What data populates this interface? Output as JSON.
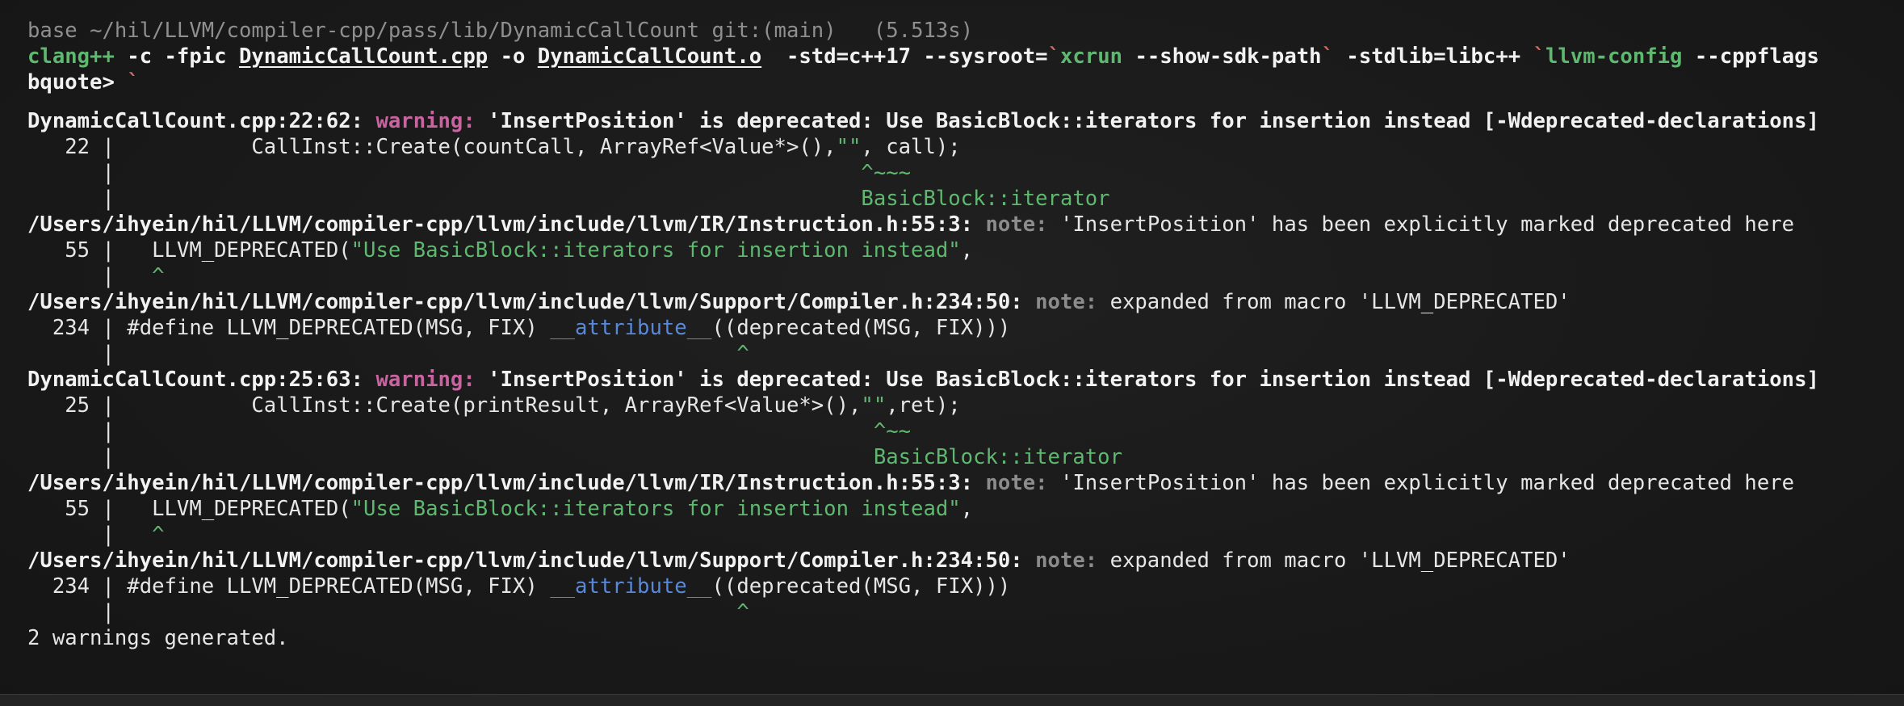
{
  "prompt": {
    "env": "base",
    "path": "~/hil/LLVM/compiler-cpp/pass/lib/DynamicCallCount",
    "git": "git:(main)",
    "duration": "(5.513s)"
  },
  "command": {
    "compiler": "clang++",
    "flags1": " -c -fpic ",
    "source_file": "DynamicCallCount.cpp",
    "out_flag": " -o ",
    "object_file": "DynamicCallCount.o",
    "flags2": "  -std=c++17 --sysroot=",
    "tick1": "`",
    "xcrun": "xcrun",
    "sdk_flag": " --show-sdk-path",
    "tick2": "`",
    "stdlib": " -stdlib=libc++ ",
    "tick3": "`",
    "llvm_config": "llvm-config",
    "cppflags": " --cppflags",
    "bquote": "bquote> ",
    "bquote_tick": "`"
  },
  "diagnostics": [
    {
      "warning_loc": "DynamicCallCount.cpp:22:62:",
      "warning_label": "warning:",
      "warning_msg": " 'InsertPosition' is deprecated: Use BasicBlock::iterators for insertion instead [-Wdeprecated-declarations]",
      "src_gutter": "   22 | ",
      "src_pre": "          CallInst::Create(countCall, ArrayRef<Value*>(),",
      "src_str": "\"\"",
      "src_post": ", call);",
      "caret_gutter": "      | ",
      "caret_pad": "                                                           ",
      "caret": "^~~~",
      "fix_gutter": "      | ",
      "fix_pad": "                                                           ",
      "fix": "BasicBlock::iterator",
      "note1_loc": "/Users/ihyein/hil/LLVM/compiler-cpp/llvm/include/llvm/IR/Instruction.h:55:3:",
      "note1_label": "note:",
      "note1_msg": " 'InsertPosition' has been explicitly marked deprecated here",
      "note1_gutter": "   55 | ",
      "note1_pre": "  LLVM_DEPRECATED(",
      "note1_str": "\"Use BasicBlock::iterators for insertion instead\"",
      "note1_post": ",",
      "note1_caret_gutter": "      | ",
      "note1_caret_pad": "  ",
      "note1_caret": "^",
      "note2_loc": "/Users/ihyein/hil/LLVM/compiler-cpp/llvm/include/llvm/Support/Compiler.h:234:50:",
      "note2_label": "note:",
      "note2_msg": " expanded from macro 'LLVM_DEPRECATED'",
      "note2_gutter": "  234 | ",
      "note2_pre": "#define LLVM_DEPRECATED(MSG, FIX) ",
      "note2_attr": "__attribute__",
      "note2_post": "((deprecated(MSG, FIX)))",
      "note2_caret_gutter": "      | ",
      "note2_caret_pad": "                                                 ",
      "note2_caret": "^"
    },
    {
      "warning_loc": "DynamicCallCount.cpp:25:63:",
      "warning_label": "warning:",
      "warning_msg": " 'InsertPosition' is deprecated: Use BasicBlock::iterators for insertion instead [-Wdeprecated-declarations]",
      "src_gutter": "   25 | ",
      "src_pre": "          CallInst::Create(printResult, ArrayRef<Value*>(),",
      "src_str": "\"\"",
      "src_post": ",ret);",
      "caret_gutter": "      | ",
      "caret_pad": "                                                            ",
      "caret": "^~~",
      "fix_gutter": "      | ",
      "fix_pad": "                                                            ",
      "fix": "BasicBlock::iterator",
      "note1_loc": "/Users/ihyein/hil/LLVM/compiler-cpp/llvm/include/llvm/IR/Instruction.h:55:3:",
      "note1_label": "note:",
      "note1_msg": " 'InsertPosition' has been explicitly marked deprecated here",
      "note1_gutter": "   55 | ",
      "note1_pre": "  LLVM_DEPRECATED(",
      "note1_str": "\"Use BasicBlock::iterators for insertion instead\"",
      "note1_post": ",",
      "note1_caret_gutter": "      | ",
      "note1_caret_pad": "  ",
      "note1_caret": "^",
      "note2_loc": "/Users/ihyein/hil/LLVM/compiler-cpp/llvm/include/llvm/Support/Compiler.h:234:50:",
      "note2_label": "note:",
      "note2_msg": " expanded from macro 'LLVM_DEPRECATED'",
      "note2_gutter": "  234 | ",
      "note2_pre": "#define LLVM_DEPRECATED(MSG, FIX) ",
      "note2_attr": "__attribute__",
      "note2_post": "((deprecated(MSG, FIX)))",
      "note2_caret_gutter": "      | ",
      "note2_caret_pad": "                                                 ",
      "note2_caret": "^"
    }
  ],
  "summary": "2 warnings generated.",
  "colors": {
    "background": "#1a1a1a",
    "text": "#e6e6e6",
    "green": "#5fb86f",
    "warning": "#c8649f",
    "note": "#8c8c8c",
    "attribute": "#5a88d8",
    "backtick": "#d86a5a"
  }
}
